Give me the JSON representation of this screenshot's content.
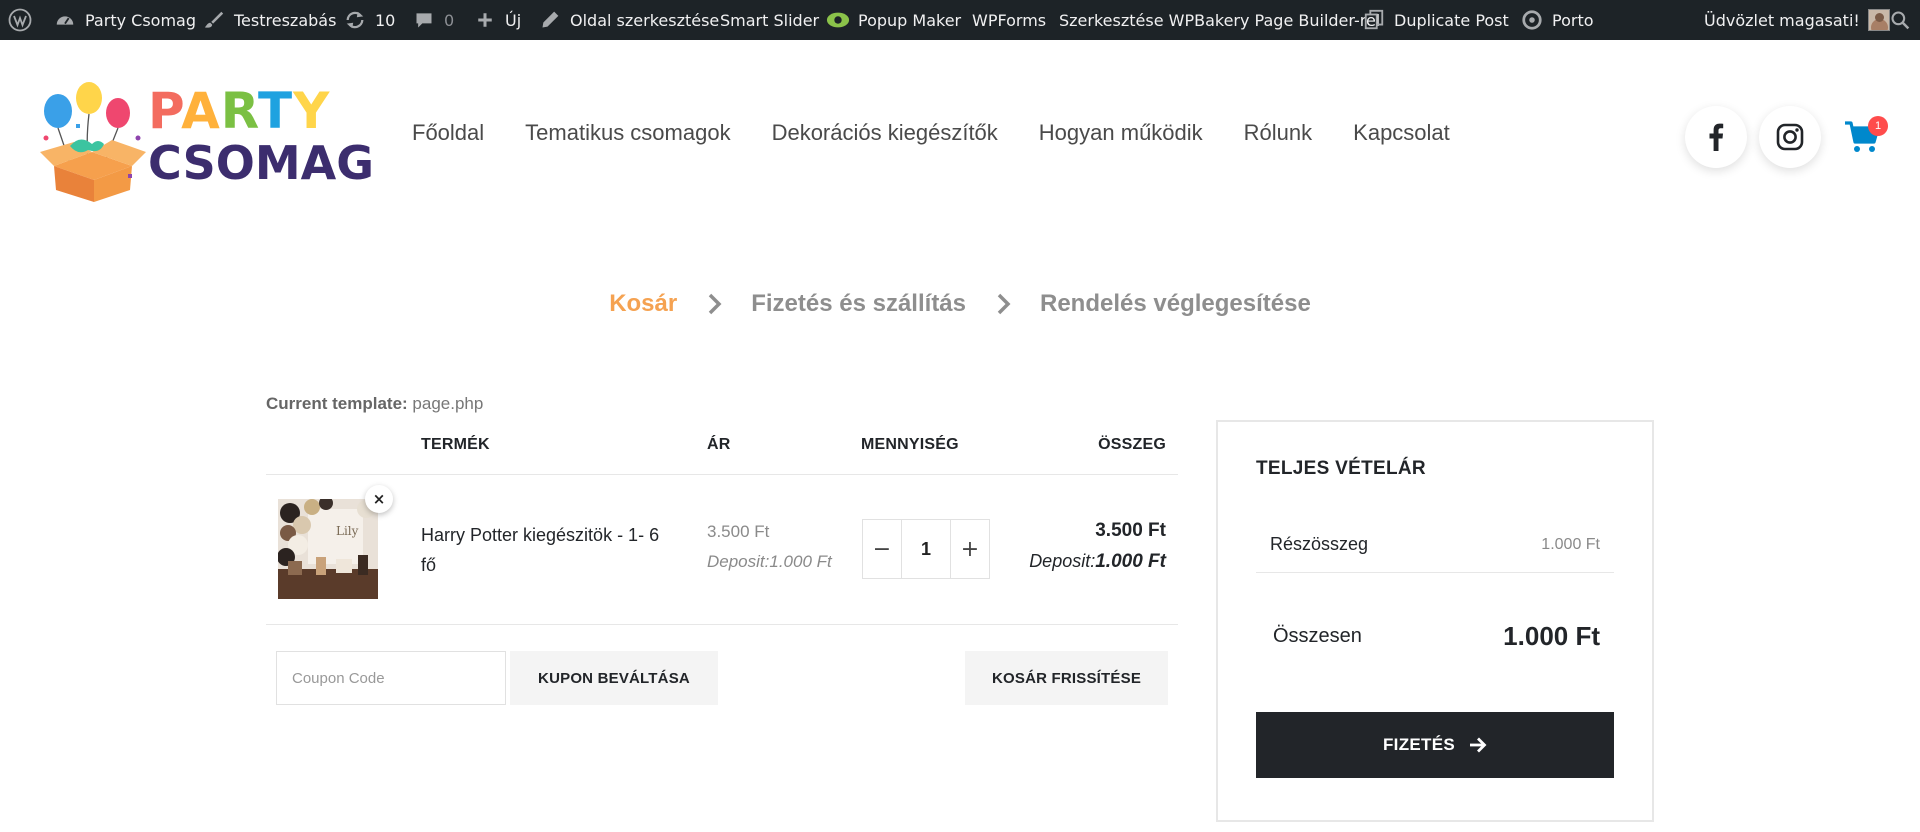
{
  "admin_bar": {
    "site_name": "Party Csomag",
    "customize": "Testreszabás",
    "updates_count": "10",
    "comments_count": "0",
    "new": "Új",
    "edit_page": "Oldal szerkesztése",
    "smart_slider": "Smart Slider",
    "popup_maker": "Popup Maker",
    "wpforms": "WPForms",
    "wpbakery": "Szerkesztése WPBakery Page Builder-rel",
    "duplicate_post": "Duplicate Post",
    "porto": "Porto",
    "greeting": "Üdvözlet magasati!"
  },
  "logo": {
    "line1": "PARTY",
    "line2": "CSOMAG"
  },
  "nav": {
    "items": [
      "Főoldal",
      "Tematikus csomagok",
      "Dekorációs kiegészítők",
      "Hogyan működik",
      "Rólunk",
      "Kapcsolat"
    ]
  },
  "header_icons": {
    "facebook": "facebook-icon",
    "instagram": "instagram-icon",
    "cart": "cart-icon",
    "cart_count": "1"
  },
  "steps": {
    "cart": "Kosár",
    "checkout": "Fizetés és szállítás",
    "complete": "Rendelés véglegesítése"
  },
  "template_note": {
    "label": "Current template:",
    "value": "page.php"
  },
  "cart_table": {
    "headers": {
      "product": "TERMÉK",
      "price": "ÁR",
      "quantity": "MENNYISÉG",
      "total": "ÖSSZEG"
    },
    "rows": [
      {
        "name": "Harry Potter kiegészitök - 1- 6 fő",
        "price": "3.500 Ft",
        "deposit_label": "Deposit:",
        "price_deposit": "1.000 Ft",
        "quantity": "1",
        "total": "3.500 Ft",
        "total_deposit": "1.000 Ft"
      }
    ],
    "remove_symbol": "×",
    "qty_minus": "−",
    "qty_plus": "+"
  },
  "coupon": {
    "placeholder": "Coupon Code",
    "apply_label": "KUPON BEVÁLTÁSA",
    "update_label": "KOSÁR FRISSÍTÉSE"
  },
  "totals": {
    "title": "TELJES VÉTELÁR",
    "subtotal_label": "Részösszeg",
    "subtotal_value": "1.000 Ft",
    "total_label": "Összesen",
    "total_value": "1.000 Ft",
    "checkout_label": "FIZETÉS"
  },
  "colors": {
    "admin_bar_bg": "#1d2327",
    "accent_orange": "#f5a251",
    "dark": "#222529",
    "cart_blue": "#0088cc",
    "badge_red": "#ff4c4c"
  }
}
